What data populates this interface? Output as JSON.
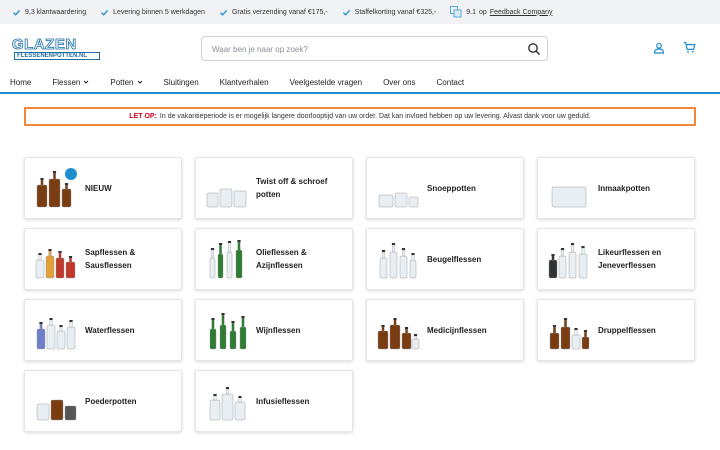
{
  "usp_bar": {
    "items": [
      "9,3 klantwaardering",
      "Levering binnen 5 werkdagen",
      "Gratis verzending vanaf €175,-",
      "Staffelkorting vanaf €325,-"
    ],
    "rating_score": "9.1",
    "rating_prefix": "op",
    "rating_link": "Feedback Company"
  },
  "header": {
    "logo_top": "GLAZEN",
    "logo_bottom": "FLESSENENPOTTEN.NL",
    "search_placeholder": "Waar ben je naar op zoek?",
    "search_value": ""
  },
  "nav": {
    "items": [
      {
        "label": "Home",
        "dropdown": false
      },
      {
        "label": "Flessen",
        "dropdown": true
      },
      {
        "label": "Potten",
        "dropdown": true
      },
      {
        "label": "Sluitingen",
        "dropdown": false
      },
      {
        "label": "Klantverhalen",
        "dropdown": false
      },
      {
        "label": "Veelgestelde vragen",
        "dropdown": false
      },
      {
        "label": "Over ons",
        "dropdown": false
      },
      {
        "label": "Contact",
        "dropdown": false
      }
    ]
  },
  "notice": {
    "strong": "LET OP:",
    "text": "In de vakantieperiode is er mogelijk langere doorlooptijd van uw order. Dat kan invloed hebben op uw levering. Alvast dank voor uw geduld."
  },
  "categories": [
    {
      "label": "NIEUW",
      "icon": "new-bottles-icon"
    },
    {
      "label": "Twist off & schroef potten",
      "icon": "twist-off-jars-icon"
    },
    {
      "label": "Snoeppotten",
      "icon": "candy-jars-icon"
    },
    {
      "label": "Inmaakpotten",
      "icon": "preserving-jar-icon"
    },
    {
      "label": "Sapflessen & Sausflessen",
      "icon": "juice-bottles-icon"
    },
    {
      "label": "Olieflessen & Azijnflessen",
      "icon": "oil-bottles-icon"
    },
    {
      "label": "Beugelflessen",
      "icon": "swing-top-bottles-icon"
    },
    {
      "label": "Likeurflessen en Jeneverflessen",
      "icon": "liqueur-bottles-icon"
    },
    {
      "label": "Waterflessen",
      "icon": "water-bottles-icon"
    },
    {
      "label": "Wijnflessen",
      "icon": "wine-bottles-icon"
    },
    {
      "label": "Medicijnflessen",
      "icon": "medicine-bottles-icon"
    },
    {
      "label": "Druppelflessen",
      "icon": "dropper-bottles-icon"
    },
    {
      "label": "Poederpotten",
      "icon": "powder-jars-icon"
    },
    {
      "label": "Infusieflessen",
      "icon": "infusion-bottles-icon"
    }
  ],
  "colors": {
    "accent": "#1d8fd1",
    "notice_border": "#f0883a",
    "notice_strong": "#d0021b",
    "amber_glass": "#7a3d12",
    "green_glass": "#2e7d32"
  }
}
